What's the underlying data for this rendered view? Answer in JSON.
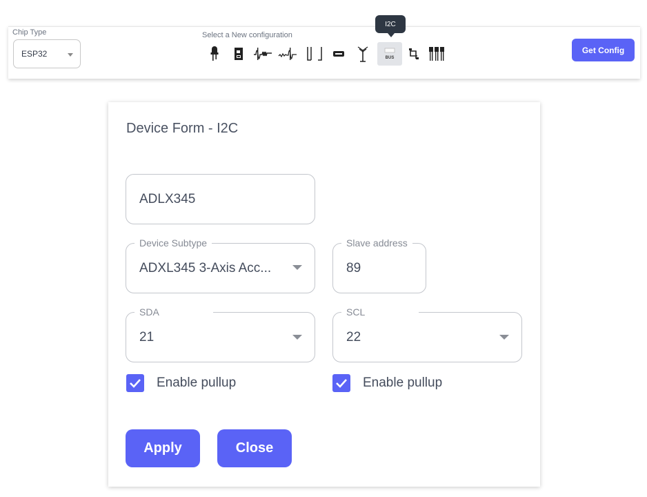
{
  "toolbar": {
    "chip_type_label": "Chip Type",
    "chip_type_value": "ESP32",
    "config_label": "Select a New configuration",
    "tooltip": "I2C",
    "get_config_label": "Get Config",
    "icons": [
      "led-icon",
      "relay-icon",
      "pwm-icon",
      "analog-icon",
      "pulse-icon",
      "uart-icon",
      "antenna-icon",
      "i2c-bus-icon",
      "wiring-icon",
      "pin-header-icon"
    ],
    "active_icon": "i2c-bus-icon",
    "i2c_icon_text": "BUS"
  },
  "form": {
    "title": "Device Form - I2C",
    "device_name": "ADLX345",
    "subtype_label": "Device Subtype",
    "subtype_value": "ADXL345 3-Axis Acc...",
    "slave_address_label": "Slave address",
    "slave_address_value": "89",
    "sda_label": "SDA",
    "sda_value": "21",
    "scl_label": "SCL",
    "scl_value": "22",
    "sda_pullup_label": "Enable pullup",
    "sda_pullup_checked": true,
    "scl_pullup_label": "Enable pullup",
    "scl_pullup_checked": true,
    "apply_label": "Apply",
    "close_label": "Close"
  },
  "colors": {
    "accent": "#5a63f6",
    "tooltip_bg": "#2e3743"
  }
}
